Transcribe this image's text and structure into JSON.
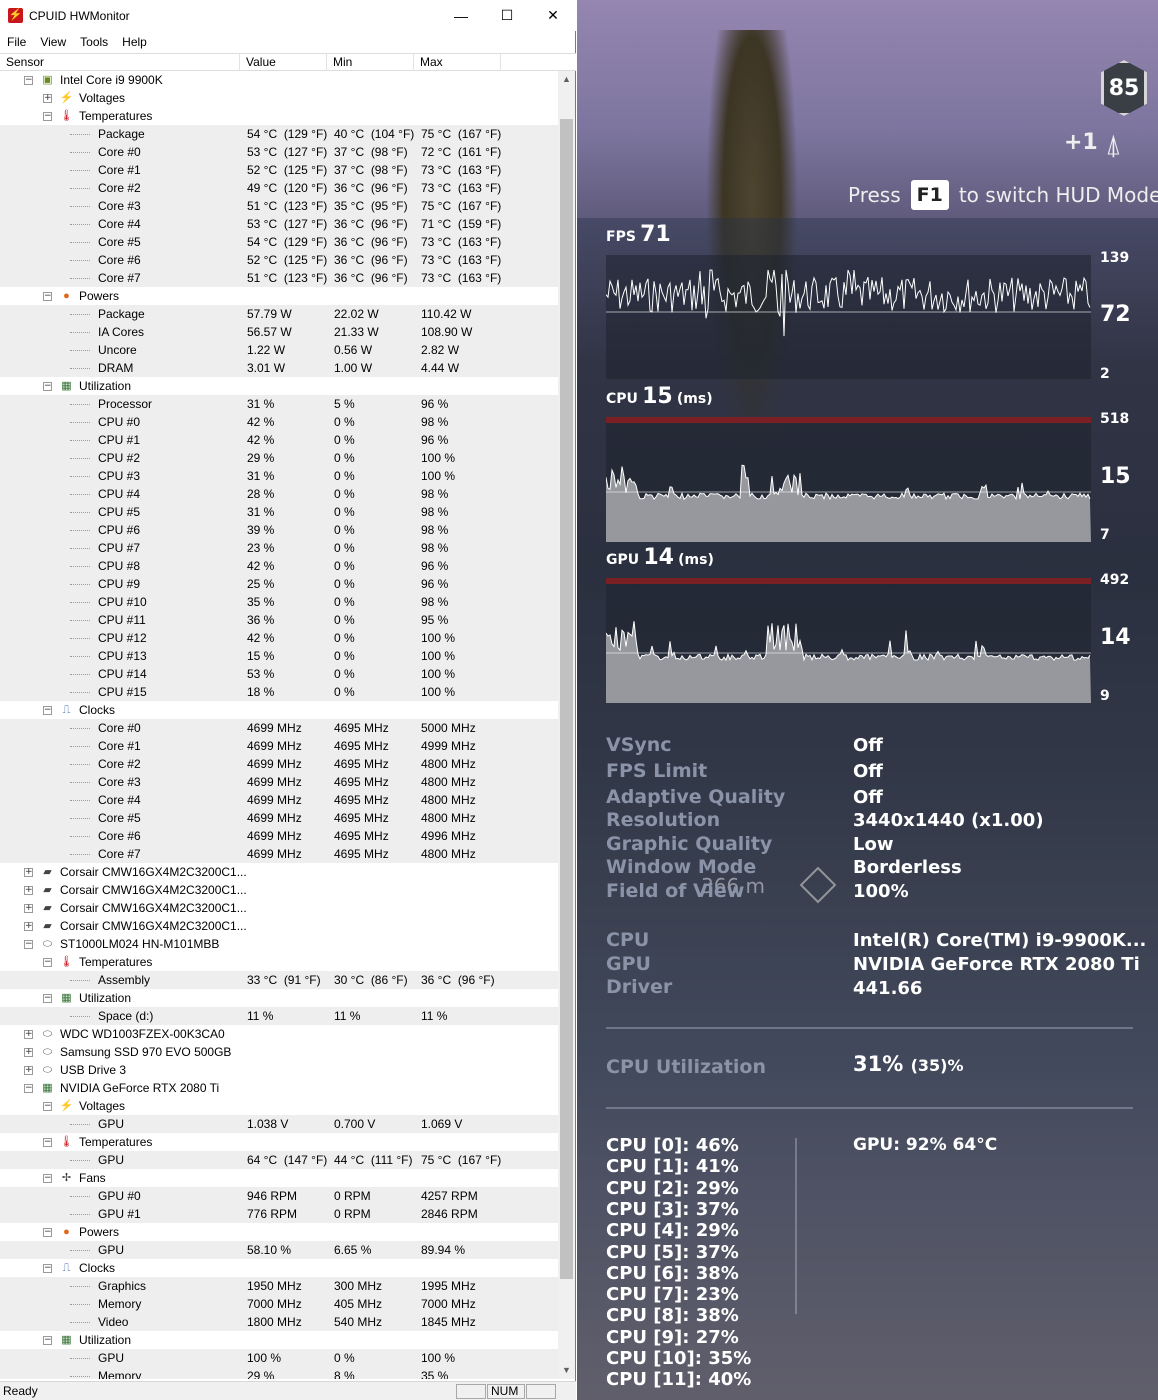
{
  "window": {
    "title": "CPUID HWMonitor",
    "controls": {
      "minimize": "—",
      "maximize": "☐",
      "close": "✕"
    }
  },
  "menu": [
    "File",
    "View",
    "Tools",
    "Help"
  ],
  "columns": {
    "sensor": "Sensor",
    "value": "Value",
    "min": "Min",
    "max": "Max"
  },
  "tree": [
    {
      "level": 1,
      "toggle": "-",
      "icon": "chip-icon",
      "label": "Intel Core i9 9900K"
    },
    {
      "level": 2,
      "toggle": "+",
      "icon": "voltage-icon",
      "label": "Voltages"
    },
    {
      "level": 2,
      "toggle": "-",
      "icon": "thermometer-icon",
      "label": "Temperatures"
    },
    {
      "level": 3,
      "label": "Package",
      "value": "54 °C  (129 °F)",
      "min": "40 °C  (104 °F)",
      "max": "75 °C  (167 °F)"
    },
    {
      "level": 3,
      "label": "Core #0",
      "value": "53 °C  (127 °F)",
      "min": "37 °C  (98 °F)",
      "max": "72 °C  (161 °F)"
    },
    {
      "level": 3,
      "label": "Core #1",
      "value": "52 °C  (125 °F)",
      "min": "37 °C  (98 °F)",
      "max": "73 °C  (163 °F)"
    },
    {
      "level": 3,
      "label": "Core #2",
      "value": "49 °C  (120 °F)",
      "min": "36 °C  (96 °F)",
      "max": "73 °C  (163 °F)"
    },
    {
      "level": 3,
      "label": "Core #3",
      "value": "51 °C  (123 °F)",
      "min": "35 °C  (95 °F)",
      "max": "75 °C  (167 °F)"
    },
    {
      "level": 3,
      "label": "Core #4",
      "value": "53 °C  (127 °F)",
      "min": "36 °C  (96 °F)",
      "max": "71 °C  (159 °F)"
    },
    {
      "level": 3,
      "label": "Core #5",
      "value": "54 °C  (129 °F)",
      "min": "36 °C  (96 °F)",
      "max": "73 °C  (163 °F)"
    },
    {
      "level": 3,
      "label": "Core #6",
      "value": "52 °C  (125 °F)",
      "min": "36 °C  (96 °F)",
      "max": "73 °C  (163 °F)"
    },
    {
      "level": 3,
      "label": "Core #7",
      "value": "51 °C  (123 °F)",
      "min": "36 °C  (96 °F)",
      "max": "73 °C  (163 °F)"
    },
    {
      "level": 2,
      "toggle": "-",
      "icon": "power-icon",
      "label": "Powers"
    },
    {
      "level": 3,
      "label": "Package",
      "value": "57.79 W",
      "min": "22.02 W",
      "max": "110.42 W"
    },
    {
      "level": 3,
      "label": "IA Cores",
      "value": "56.57 W",
      "min": "21.33 W",
      "max": "108.90 W"
    },
    {
      "level": 3,
      "label": "Uncore",
      "value": "1.22 W",
      "min": "0.56 W",
      "max": "2.82 W"
    },
    {
      "level": 3,
      "label": "DRAM",
      "value": "3.01 W",
      "min": "1.00 W",
      "max": "4.44 W"
    },
    {
      "level": 2,
      "toggle": "-",
      "icon": "utilization-icon",
      "label": "Utilization"
    },
    {
      "level": 3,
      "label": "Processor",
      "value": "31 %",
      "min": "5 %",
      "max": "96 %"
    },
    {
      "level": 3,
      "label": "CPU #0",
      "value": "42 %",
      "min": "0 %",
      "max": "98 %"
    },
    {
      "level": 3,
      "label": "CPU #1",
      "value": "42 %",
      "min": "0 %",
      "max": "96 %"
    },
    {
      "level": 3,
      "label": "CPU #2",
      "value": "29 %",
      "min": "0 %",
      "max": "100 %"
    },
    {
      "level": 3,
      "label": "CPU #3",
      "value": "31 %",
      "min": "0 %",
      "max": "100 %"
    },
    {
      "level": 3,
      "label": "CPU #4",
      "value": "28 %",
      "min": "0 %",
      "max": "98 %"
    },
    {
      "level": 3,
      "label": "CPU #5",
      "value": "31 %",
      "min": "0 %",
      "max": "98 %"
    },
    {
      "level": 3,
      "label": "CPU #6",
      "value": "39 %",
      "min": "0 %",
      "max": "98 %"
    },
    {
      "level": 3,
      "label": "CPU #7",
      "value": "23 %",
      "min": "0 %",
      "max": "98 %"
    },
    {
      "level": 3,
      "label": "CPU #8",
      "value": "42 %",
      "min": "0 %",
      "max": "96 %"
    },
    {
      "level": 3,
      "label": "CPU #9",
      "value": "25 %",
      "min": "0 %",
      "max": "96 %"
    },
    {
      "level": 3,
      "label": "CPU #10",
      "value": "35 %",
      "min": "0 %",
      "max": "98 %"
    },
    {
      "level": 3,
      "label": "CPU #11",
      "value": "36 %",
      "min": "0 %",
      "max": "95 %"
    },
    {
      "level": 3,
      "label": "CPU #12",
      "value": "42 %",
      "min": "0 %",
      "max": "100 %"
    },
    {
      "level": 3,
      "label": "CPU #13",
      "value": "15 %",
      "min": "0 %",
      "max": "100 %"
    },
    {
      "level": 3,
      "label": "CPU #14",
      "value": "53 %",
      "min": "0 %",
      "max": "100 %"
    },
    {
      "level": 3,
      "label": "CPU #15",
      "value": "18 %",
      "min": "0 %",
      "max": "100 %"
    },
    {
      "level": 2,
      "toggle": "-",
      "icon": "clock-icon",
      "label": "Clocks"
    },
    {
      "level": 3,
      "label": "Core #0",
      "value": "4699 MHz",
      "min": "4695 MHz",
      "max": "5000 MHz"
    },
    {
      "level": 3,
      "label": "Core #1",
      "value": "4699 MHz",
      "min": "4695 MHz",
      "max": "4999 MHz"
    },
    {
      "level": 3,
      "label": "Core #2",
      "value": "4699 MHz",
      "min": "4695 MHz",
      "max": "4800 MHz"
    },
    {
      "level": 3,
      "label": "Core #3",
      "value": "4699 MHz",
      "min": "4695 MHz",
      "max": "4800 MHz"
    },
    {
      "level": 3,
      "label": "Core #4",
      "value": "4699 MHz",
      "min": "4695 MHz",
      "max": "4800 MHz"
    },
    {
      "level": 3,
      "label": "Core #5",
      "value": "4699 MHz",
      "min": "4695 MHz",
      "max": "4800 MHz"
    },
    {
      "level": 3,
      "label": "Core #6",
      "value": "4699 MHz",
      "min": "4695 MHz",
      "max": "4996 MHz"
    },
    {
      "level": 3,
      "label": "Core #7",
      "value": "4699 MHz",
      "min": "4695 MHz",
      "max": "4800 MHz"
    },
    {
      "level": 1,
      "toggle": "+",
      "icon": "memory-icon",
      "label": "Corsair CMW16GX4M2C3200C1..."
    },
    {
      "level": 1,
      "toggle": "+",
      "icon": "memory-icon",
      "label": "Corsair CMW16GX4M2C3200C1..."
    },
    {
      "level": 1,
      "toggle": "+",
      "icon": "memory-icon",
      "label": "Corsair CMW16GX4M2C3200C1..."
    },
    {
      "level": 1,
      "toggle": "+",
      "icon": "memory-icon",
      "label": "Corsair CMW16GX4M2C3200C1..."
    },
    {
      "level": 1,
      "toggle": "-",
      "icon": "drive-icon",
      "label": "ST1000LM024 HN-M101MBB"
    },
    {
      "level": 2,
      "toggle": "-",
      "icon": "thermometer-icon",
      "label": "Temperatures"
    },
    {
      "level": 3,
      "label": "Assembly",
      "value": "33 °C  (91 °F)",
      "min": "30 °C  (86 °F)",
      "max": "36 °C  (96 °F)"
    },
    {
      "level": 2,
      "toggle": "-",
      "icon": "utilization-icon",
      "label": "Utilization"
    },
    {
      "level": 3,
      "label": "Space (d:)",
      "value": "11 %",
      "min": "11 %",
      "max": "11 %"
    },
    {
      "level": 1,
      "toggle": "+",
      "icon": "drive-icon",
      "label": "WDC WD1003FZEX-00K3CA0"
    },
    {
      "level": 1,
      "toggle": "+",
      "icon": "drive-icon",
      "label": "Samsung SSD 970 EVO 500GB"
    },
    {
      "level": 1,
      "toggle": "+",
      "icon": "drive-icon",
      "label": "USB Drive 3"
    },
    {
      "level": 1,
      "toggle": "-",
      "icon": "gpu-icon",
      "label": "NVIDIA GeForce RTX 2080 Ti"
    },
    {
      "level": 2,
      "toggle": "-",
      "icon": "voltage-icon",
      "label": "Voltages"
    },
    {
      "level": 3,
      "label": "GPU",
      "value": "1.038 V",
      "min": "0.700 V",
      "max": "1.069 V"
    },
    {
      "level": 2,
      "toggle": "-",
      "icon": "thermometer-icon",
      "label": "Temperatures"
    },
    {
      "level": 3,
      "label": "GPU",
      "value": "64 °C  (147 °F)",
      "min": "44 °C  (111 °F)",
      "max": "75 °C  (167 °F)"
    },
    {
      "level": 2,
      "toggle": "-",
      "icon": "fan-icon",
      "label": "Fans"
    },
    {
      "level": 3,
      "label": "GPU #0",
      "value": "946 RPM",
      "min": "0 RPM",
      "max": "4257 RPM"
    },
    {
      "level": 3,
      "label": "GPU #1",
      "value": "776 RPM",
      "min": "0 RPM",
      "max": "2846 RPM"
    },
    {
      "level": 2,
      "toggle": "-",
      "icon": "power-icon",
      "label": "Powers"
    },
    {
      "level": 3,
      "label": "GPU",
      "value": "58.10 %",
      "min": "6.65 %",
      "max": "89.94 %"
    },
    {
      "level": 2,
      "toggle": "-",
      "icon": "clock-icon",
      "label": "Clocks"
    },
    {
      "level": 3,
      "label": "Graphics",
      "value": "1950 MHz",
      "min": "300 MHz",
      "max": "1995 MHz"
    },
    {
      "level": 3,
      "label": "Memory",
      "value": "7000 MHz",
      "min": "405 MHz",
      "max": "7000 MHz"
    },
    {
      "level": 3,
      "label": "Video",
      "value": "1800 MHz",
      "min": "540 MHz",
      "max": "1845 MHz"
    },
    {
      "level": 2,
      "toggle": "-",
      "icon": "utilization-icon",
      "label": "Utilization"
    },
    {
      "level": 3,
      "label": "GPU",
      "value": "100 %",
      "min": "0 %",
      "max": "100 %"
    },
    {
      "level": 3,
      "label": "Memory",
      "value": "29 %",
      "min": "8 %",
      "max": "35 %"
    }
  ],
  "status": {
    "text": "Ready",
    "num": "NUM"
  },
  "game": {
    "level_badge": "85",
    "plus_one": "+1",
    "hud_hint": {
      "before": "Press",
      "key": "F1",
      "after": "to switch HUD Mode"
    },
    "waypoint_distance": "366 m",
    "graphs": [
      {
        "id": "fps",
        "label": "FPS",
        "value": "71",
        "unit": "",
        "top": "139",
        "mid": "72",
        "bottom": "2"
      },
      {
        "id": "cpu",
        "label": "CPU",
        "value": "15",
        "unit": "(ms)",
        "top": "518",
        "mid": "15",
        "bottom": "7"
      },
      {
        "id": "gpu",
        "label": "GPU",
        "value": "14",
        "unit": "(ms)",
        "top": "492",
        "mid": "14",
        "bottom": "9"
      }
    ],
    "settings": [
      {
        "label": "VSync",
        "value": "Off"
      },
      {
        "label": "FPS Limit",
        "value": "Off"
      },
      {
        "label": "Adaptive Quality",
        "value": "Off"
      },
      {
        "label": "Resolution",
        "value": "3440x1440 (x1.00)"
      },
      {
        "label": "Graphic Quality",
        "value": "Low"
      },
      {
        "label": "Window Mode",
        "value": "Borderless"
      },
      {
        "label": "Field of View",
        "value": "100%"
      }
    ],
    "hardware": [
      {
        "label": "CPU",
        "value": "Intel(R) Core(TM) i9-9900K..."
      },
      {
        "label": "GPU",
        "value": "NVIDIA GeForce RTX 2080 Ti"
      },
      {
        "label": "Driver",
        "value": "441.66"
      }
    ],
    "cpu_utilization": {
      "label": "CPU Utilization",
      "value": "31%",
      "extra": "(35)%"
    },
    "cores": [
      "CPU [0]: 46%",
      "CPU [1]: 41%",
      "CPU [2]: 29%",
      "CPU [3]: 37%",
      "CPU [4]: 29%",
      "CPU [5]: 37%",
      "CPU [6]: 38%",
      "CPU [7]: 23%",
      "CPU [8]: 38%",
      "CPU [9]: 27%",
      "CPU [10]: 35%",
      "CPU [11]: 40%"
    ],
    "gpu_stat": "GPU: 92% 64°C"
  }
}
